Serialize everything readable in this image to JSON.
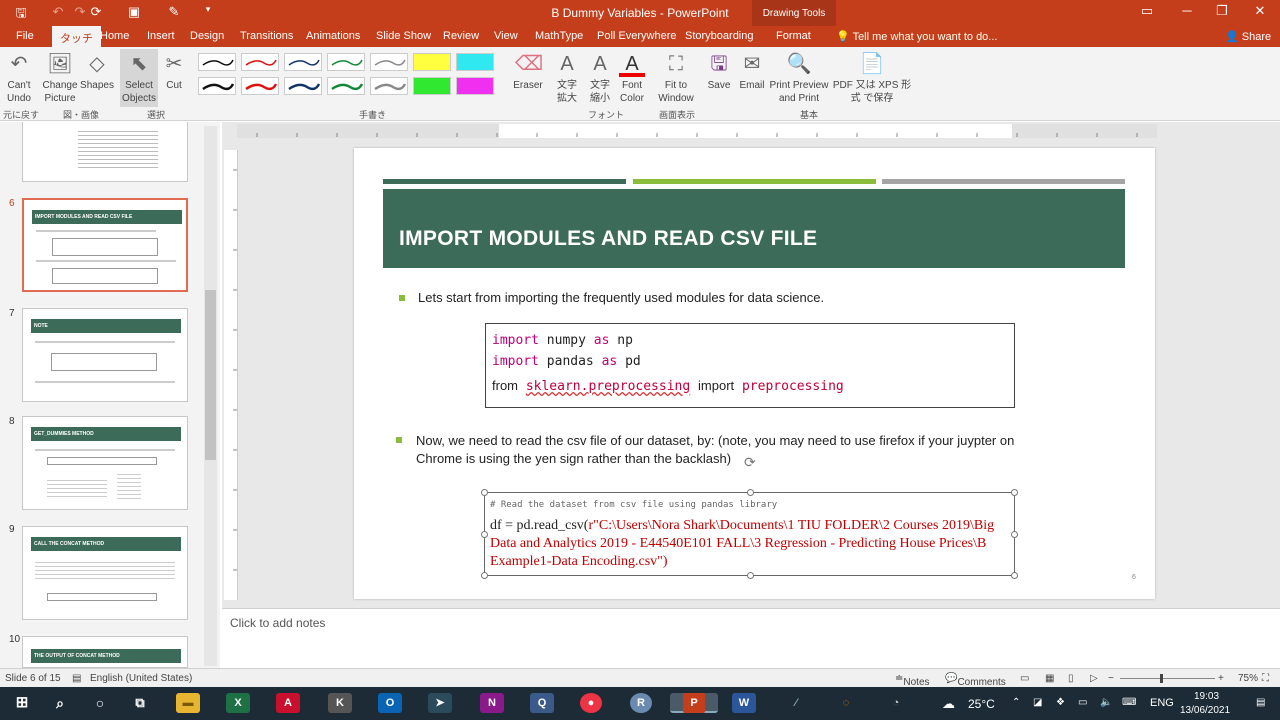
{
  "window": {
    "title": "B Dummy Variables - PowerPoint",
    "drawing_tools": "Drawing Tools"
  },
  "tabs": [
    "File",
    "タッチ",
    "Home",
    "Insert",
    "Design",
    "Transitions",
    "Animations",
    "Slide Show",
    "Review",
    "View",
    "MathType",
    "Poll Everywhere",
    "Storyboarding",
    "Format"
  ],
  "tell_me": "Tell me what you want to do...",
  "share": "Share",
  "ribbon": {
    "cant_undo": "Can't Undo",
    "change_picture": "Change Picture",
    "shapes": "Shapes",
    "select_objects": "Select Objects",
    "cut": "Cut",
    "eraser": "Eraser",
    "grow": "文字 拡大",
    "shrink": "文字 縮小",
    "font_color": "Font Color",
    "fit_window": "Fit to Window",
    "save": "Save",
    "email": "Email",
    "print_preview": "Print Preview and Print",
    "pdf": "PDF 又は XPS 形式 で保存",
    "groups": {
      "undo": "元に戻す",
      "shapes": "図・画像",
      "select": "選択",
      "pens": "手書き",
      "font": "フォント",
      "window": "画面表示",
      "basic": "基本"
    }
  },
  "thumbnails": [
    {
      "num": "6",
      "title": "IMPORT MODULES AND READ CSV FILE"
    },
    {
      "num": "7",
      "title": "NOTE"
    },
    {
      "num": "8",
      "title": "GET_DUMMIES METHOD"
    },
    {
      "num": "9",
      "title": "CALL THE CONCAT METHOD"
    },
    {
      "num": "10",
      "title": "THE OUTPUT OF CONCAT METHOD"
    }
  ],
  "slide": {
    "title": "IMPORT MODULES AND READ CSV FILE",
    "bullet1": "Lets start from importing the frequently used modules for data science.",
    "code1": {
      "l1_kw": "import",
      "l1_mod": "numpy",
      "l1_as": "as",
      "l1_alias": "np",
      "l2_kw": "import",
      "l2_mod": "pandas",
      "l2_as": "as",
      "l2_alias": "pd",
      "l3_from": "from",
      "l3_mod": "sklearn.preprocessing",
      "l3_import": "import",
      "l3_name": "preprocessing"
    },
    "bullet2_line1": "Now, we need to read the csv file of our dataset, by: (note, you may need to use firefox if your juypter on",
    "bullet2_line2": "Chrome is using the yen sign rather than the backlash)",
    "code2": {
      "comment": "# Read the dataset from csv file using pandas library",
      "prefix": "df = pd.read_csv(",
      "string": "r\"C:\\Users\\Nora Shark\\Documents\\1 TIU FOLDER\\2 Courses 2019\\Big Data and Analytics 2019 - E44540E101 FALL\\3 Regression - Predicting House Prices\\B Example1-Data Encoding.csv\")"
    },
    "page_number": "6"
  },
  "notes_placeholder": "Click to add notes",
  "status": {
    "slide": "Slide 6 of 15",
    "language": "English (United States)",
    "notes": "Notes",
    "comments": "Comments",
    "zoom": "75%"
  },
  "taskbar": {
    "weather": "25°C",
    "lang": "ENG",
    "time": "19:03",
    "date": "13/06/2021"
  }
}
